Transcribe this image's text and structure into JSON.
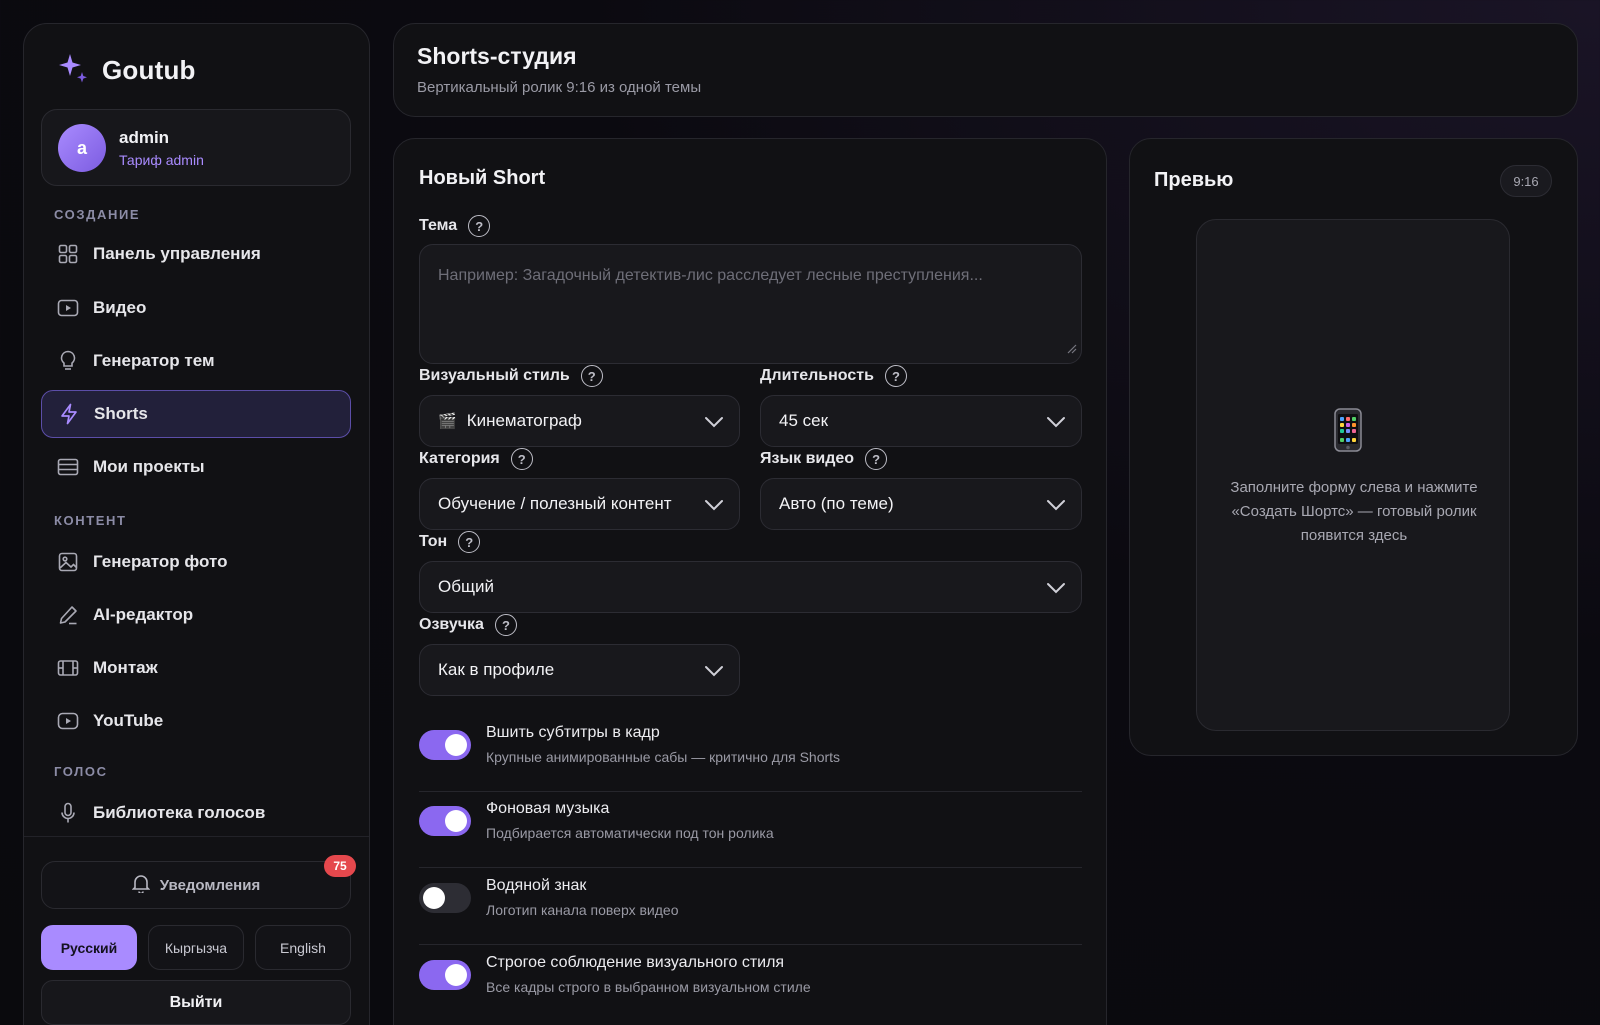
{
  "app": {
    "name": "Goutub"
  },
  "user": {
    "initial": "a",
    "name": "admin",
    "plan": "Тариф admin"
  },
  "sidebar": {
    "sections": [
      {
        "label": "СОЗДАНИЕ"
      },
      {
        "label": "КОНТЕНТ"
      },
      {
        "label": "ГОЛОС"
      }
    ],
    "items": [
      {
        "label": "Панель управления",
        "icon": "dashboard-icon"
      },
      {
        "label": "Видео",
        "icon": "video-icon"
      },
      {
        "label": "Генератор тем",
        "icon": "lightbulb-icon"
      },
      {
        "label": "Shorts",
        "icon": "lightning-icon",
        "active": true
      },
      {
        "label": "Мои проекты",
        "icon": "projects-icon"
      },
      {
        "label": "Генератор фото",
        "icon": "image-icon"
      },
      {
        "label": "AI-редактор",
        "icon": "pencil-icon"
      },
      {
        "label": "Монтаж",
        "icon": "film-icon"
      },
      {
        "label": "YouTube",
        "icon": "youtube-icon"
      },
      {
        "label": "Библиотека голосов",
        "icon": "microphone-icon"
      }
    ],
    "notifications": {
      "label": "Уведомления",
      "count": "75"
    },
    "languages": [
      {
        "label": "Русский",
        "active": true
      },
      {
        "label": "Кыргызча"
      },
      {
        "label": "English"
      }
    ],
    "logout_label": "Выйти"
  },
  "header": {
    "title": "Shorts-студия",
    "subtitle": "Вертикальный ролик 9:16 из одной темы"
  },
  "form": {
    "title": "Новый Short",
    "topic": {
      "label": "Тема",
      "value": "",
      "placeholder": "Например: Загадочный детектив-лис расследует лесные преступления..."
    },
    "visual_style": {
      "label": "Визуальный стиль",
      "value": "Кинематограф",
      "emoji": "🎬"
    },
    "duration": {
      "label": "Длительность",
      "value": "45 сек"
    },
    "category": {
      "label": "Категория",
      "value": "Обучение / полезный контент"
    },
    "language": {
      "label": "Язык видео",
      "value": "Авто (по теме)"
    },
    "tone": {
      "label": "Тон",
      "value": "Общий"
    },
    "voice": {
      "label": "Озвучка",
      "value": "Как в профиле"
    },
    "help_glyph": "?",
    "toggles": [
      {
        "title": "Вшить субтитры в кадр",
        "desc": "Крупные анимированные сабы — критично для Shorts",
        "on": true
      },
      {
        "title": "Фоновая музыка",
        "desc": "Подбирается автоматически под тон ролика",
        "on": true
      },
      {
        "title": "Водяной знак",
        "desc": "Логотип канала поверх видео",
        "on": false
      },
      {
        "title": "Строгое соблюдение визуального стиля",
        "desc": "Все кадры строго в выбранном визуальном стиле",
        "on": true
      }
    ]
  },
  "preview": {
    "title": "Превью",
    "ratio": "9:16",
    "placeholder_icon": "phone-icon",
    "placeholder_text": "Заполните форму слева и нажмите «Создать Шортс» — готовый ролик появится здесь"
  },
  "colors": {
    "accent": "#a98bff",
    "toggle_on": "#8b68f0",
    "badge": "#e5484d",
    "card_bg": "#111114"
  }
}
